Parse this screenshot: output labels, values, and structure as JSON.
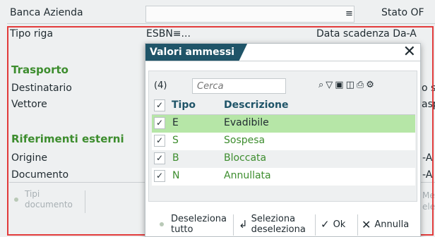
{
  "form": {
    "banca_azienda_label": "Banca Azienda",
    "banca_dropdown_glyph": "≡",
    "stato_label": "Stato OF",
    "tipo_riga_label": "Tipo riga",
    "tipo_riga_value": "ESBN≡...",
    "data_scadenza_label": "Data scadenza Da-A",
    "trasporto_section": "Trasporto",
    "destinatario_label": "Destinatario",
    "vettore_label": "Vettore",
    "right_partial_1": "o sp",
    "right_partial_2": "asp",
    "riferimenti_section": "Riferimenti esterni",
    "origine_label": "Origine",
    "documento_label": "Documento",
    "right_partial_3": "-A",
    "right_partial_4": "-A",
    "tipi_documento_label": "Tipi documento",
    "right_partial_5": "Mer",
    "right_partial_6": "ele"
  },
  "dialog": {
    "title": "Valori ammessi",
    "count": "(4)",
    "search_placeholder": "Cerca",
    "toolbar_icons": [
      "zoom-icon",
      "filter-icon",
      "save-icon",
      "copy-icon",
      "print-icon",
      "settings-icon"
    ],
    "columns": {
      "check": "✓",
      "tipo": "Tipo",
      "descrizione": "Descrizione"
    },
    "rows": [
      {
        "tipo": "E",
        "descrizione": "Evadibile",
        "selected": true
      },
      {
        "tipo": "S",
        "descrizione": "Sospesa",
        "selected": false
      },
      {
        "tipo": "B",
        "descrizione": "Bloccata",
        "selected": false
      },
      {
        "tipo": "N",
        "descrizione": "Annullata",
        "selected": false
      }
    ],
    "buttons": {
      "deseleziona_tutto": "Deseleziona tutto",
      "seleziona_deseleziona": "Seleziona deseleziona",
      "ok": "Ok",
      "annulla": "Annulla"
    }
  },
  "colors": {
    "accent_dark": "#1f5468",
    "green_text": "#3d8d2e",
    "selected_row": "#b6e6a7",
    "red_frame": "#e23b3b"
  }
}
